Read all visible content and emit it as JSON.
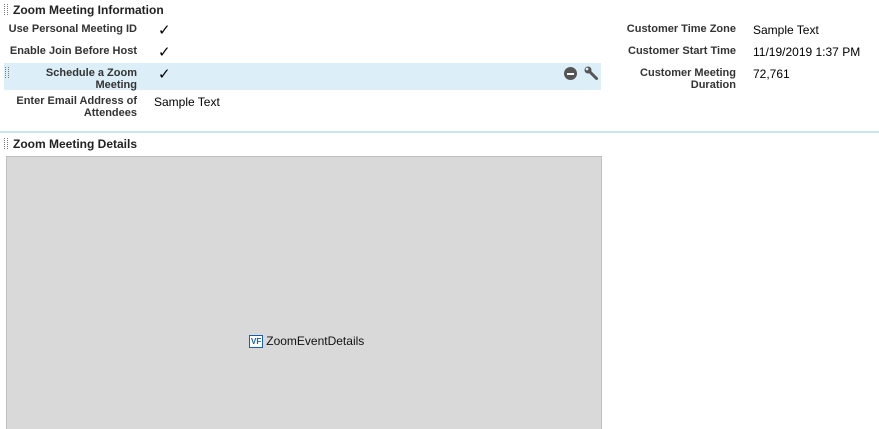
{
  "sections": {
    "info_title": "Zoom Meeting Information",
    "details_title": "Zoom Meeting Details"
  },
  "left_fields": [
    {
      "label": "Use Personal Meeting ID",
      "checked": true
    },
    {
      "label": "Enable Join Before Host",
      "checked": true
    },
    {
      "label": "Schedule a Zoom Meeting",
      "checked": true
    },
    {
      "label": "Enter Email Address of Attendees",
      "value": "Sample Text"
    }
  ],
  "right_fields": [
    {
      "label": "Customer Time Zone",
      "value": "Sample Text"
    },
    {
      "label": "Customer Start Time",
      "value": "11/19/2019 1:37 PM"
    },
    {
      "label": "Customer Meeting Duration",
      "value": "72,761"
    }
  ],
  "check_glyph": "✓",
  "icons": [
    "remove-icon",
    "wrench-icon",
    "drag-handle-icon",
    "visualforce-icon"
  ],
  "component": {
    "badge": "VF",
    "name": "ZoomEventDetails"
  },
  "colors": {
    "highlight": "#dceef8",
    "separator": "#cde4f0",
    "canvas": "#d9d9d9",
    "badge": "#1a5fa8"
  }
}
